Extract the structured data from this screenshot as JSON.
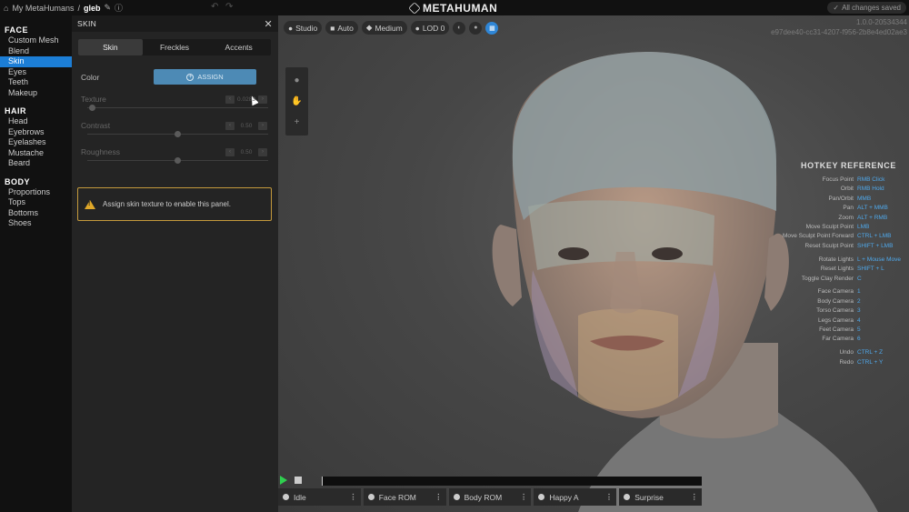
{
  "topbar": {
    "home_label": "My MetaHumans",
    "separator": "/",
    "character_name": "gleb",
    "app_name": "METAHUMAN",
    "saved_status": "All changes saved"
  },
  "nav": {
    "groups": [
      {
        "title": "FACE",
        "items": [
          "Custom Mesh",
          "Blend",
          "Skin",
          "Eyes",
          "Teeth",
          "Makeup"
        ]
      },
      {
        "title": "HAIR",
        "items": [
          "Head",
          "Eyebrows",
          "Eyelashes",
          "Mustache",
          "Beard"
        ]
      },
      {
        "title": "BODY",
        "items": [
          "Proportions",
          "Tops",
          "Bottoms",
          "Shoes"
        ]
      }
    ],
    "active_item": "Skin"
  },
  "panel": {
    "title": "SKIN",
    "tabs": [
      "Skin",
      "Freckles",
      "Accents"
    ],
    "active_tab": "Skin",
    "color_label": "Color",
    "assign_label": "ASSIGN",
    "texture_label": "Texture",
    "texture_value": "0.0283",
    "texture_level": 0.0283,
    "contrast_label": "Contrast",
    "contrast_value": "0.50",
    "contrast_level": 0.5,
    "roughness_label": "Roughness",
    "roughness_value": "0.50",
    "roughness_level": 0.5,
    "warning_text": "Assign skin texture to enable this panel."
  },
  "viewport": {
    "toolbar": [
      "Studio",
      "Auto",
      "Medium",
      "LOD 0"
    ],
    "version": "1.0.0-20534344",
    "build_id": "e97dee40-cc31-4207-f956-2b8e4ed02ae3"
  },
  "hotkeys": {
    "title": "HOTKEY REFERENCE",
    "groups": [
      [
        [
          "Focus Point",
          "RMB Click"
        ],
        [
          "Orbit",
          "RMB Hold"
        ],
        [
          "Pan/Orbit",
          "MMB"
        ],
        [
          "Pan",
          "ALT + MMB"
        ],
        [
          "Zoom",
          "ALT + RMB"
        ],
        [
          "Move Sculpt Point",
          "LMB"
        ],
        [
          "Move Sculpt Point Forward",
          "CTRL + LMB"
        ],
        [
          "Reset Sculpt Point",
          "SHIFT + LMB"
        ]
      ],
      [
        [
          "Rotate Lights",
          "L + Mouse Move"
        ],
        [
          "Reset Lights",
          "SHIFT + L"
        ],
        [
          "Toggle Clay Render",
          "C"
        ]
      ],
      [
        [
          "Face Camera",
          "1"
        ],
        [
          "Body Camera",
          "2"
        ],
        [
          "Torso Camera",
          "3"
        ],
        [
          "Legs Camera",
          "4"
        ],
        [
          "Feet Camera",
          "5"
        ],
        [
          "Far Camera",
          "6"
        ]
      ],
      [
        [
          "Undo",
          "CTRL + Z"
        ],
        [
          "Redo",
          "CTRL + Y"
        ]
      ]
    ]
  },
  "animations": [
    "Idle",
    "Face ROM",
    "Body ROM",
    "Happy A",
    "Surprise"
  ]
}
